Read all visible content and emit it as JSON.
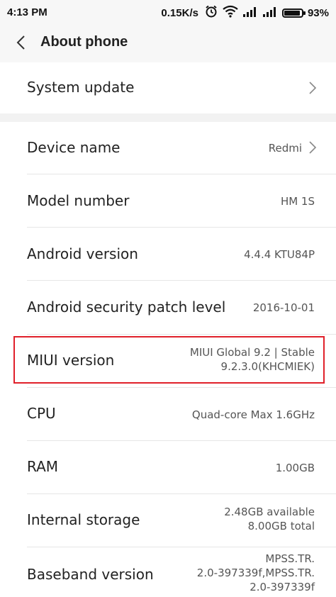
{
  "status_bar": {
    "time": "4:13 PM",
    "network_speed": "0.15K/s",
    "battery_percent": "93%",
    "battery_level": 0.93,
    "icons": [
      "alarm-icon",
      "wifi-icon",
      "signal-icon",
      "signal-icon",
      "battery-icon"
    ]
  },
  "header": {
    "back_icon": "chevron-left-icon",
    "title": "About phone"
  },
  "system_update": {
    "label": "System update",
    "icon": "chevron-right-icon"
  },
  "rows": [
    {
      "label": "Device name",
      "value": "Redmi"
    },
    {
      "label": "Model number",
      "value": "HM 1S"
    },
    {
      "label": "Android version",
      "value": "4.4.4 KTU84P"
    },
    {
      "label": "Android security patch level",
      "value": "2016-10-01"
    },
    {
      "label": "MIUI version",
      "value_line1": "MIUI Global 9.2 | Stable",
      "value_line2": "9.2.3.0(KHCMIEK)"
    },
    {
      "label": "CPU",
      "value": "Quad-core Max 1.6GHz"
    },
    {
      "label": "RAM",
      "value": "1.00GB"
    },
    {
      "label": "Internal storage",
      "value_line1": "2.48GB available",
      "value_line2": "8.00GB total"
    },
    {
      "label": "Baseband version",
      "value_line1": "MPSS.TR.",
      "value_line2": "2.0-397339f,MPSS.TR.",
      "value_line3": "2.0-397339f"
    }
  ],
  "colors": {
    "highlight_border": "#e0202a",
    "background": "#f7f7f7",
    "row_background": "#ffffff"
  }
}
